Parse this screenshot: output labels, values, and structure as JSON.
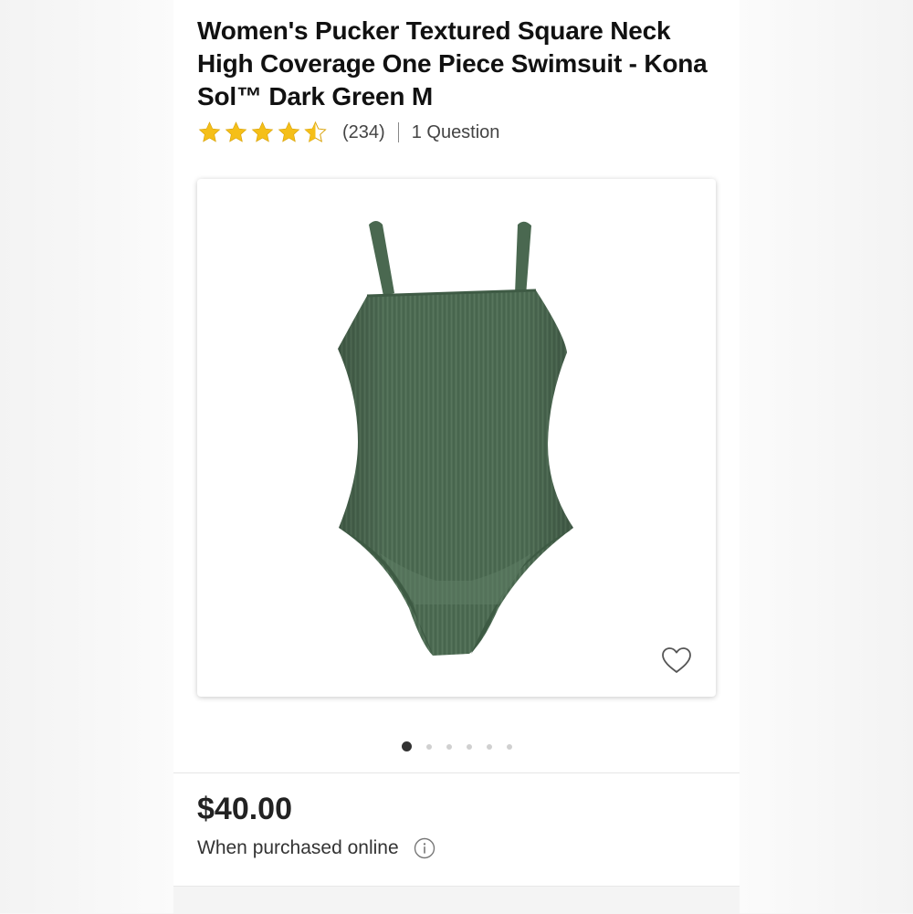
{
  "product": {
    "title": "Women's Pucker Textured Square Neck High Coverage One Piece Swimsuit - Kona Sol™ Dark Green M",
    "rating": 4.5,
    "rating_max": 5,
    "review_count": "(234)",
    "questions": "1 Question",
    "image_alt": "Dark green textured one piece swimsuit",
    "swimsuit_color": "#4e6b53",
    "star_color": "#f5bf18"
  },
  "carousel": {
    "total": 6,
    "active_index": 0
  },
  "pricing": {
    "price": "$40.00",
    "note": "When purchased online"
  },
  "icons": {
    "favorite": "heart-outline-icon",
    "info": "info-circle-icon",
    "star": "star-icon"
  }
}
